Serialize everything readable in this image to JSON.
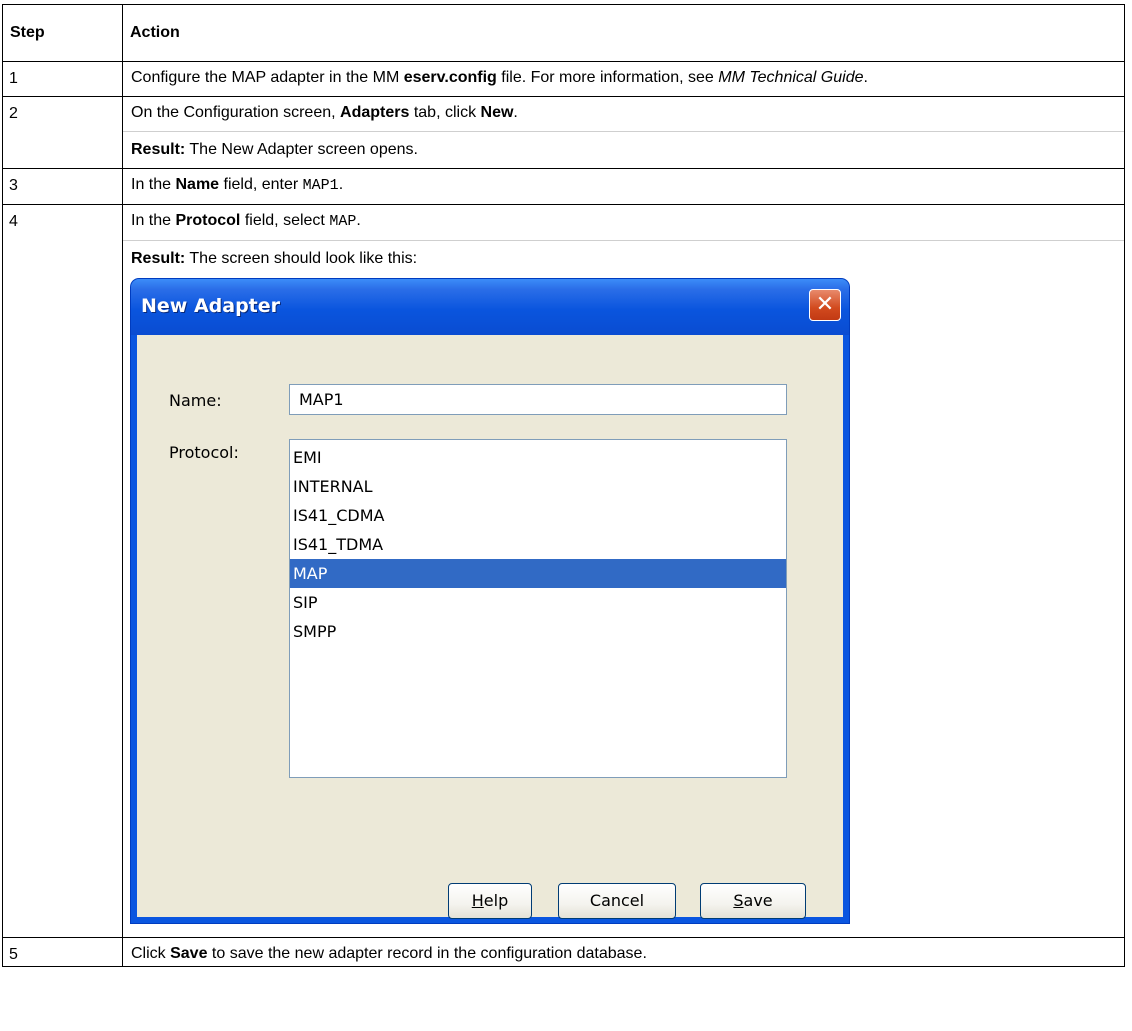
{
  "table": {
    "headers": {
      "step": "Step",
      "action": "Action"
    },
    "step1": {
      "num": "1",
      "t1": "Configure the MAP adapter in the MM ",
      "b1": "eserv.config",
      "t2": " file. For more information, see ",
      "i1": "MM Technical Guide",
      "t3": "."
    },
    "step2": {
      "num": "2",
      "t1": "On the Configuration screen, ",
      "b1": "Adapters",
      "t2": " tab, click ",
      "b2": "New",
      "t3": ".",
      "result_label": "Result:",
      "result_text": " The New Adapter screen opens."
    },
    "step3": {
      "num": "3",
      "t1": "In the ",
      "b1": "Name",
      "t2": " field, enter ",
      "code": "MAP1",
      "t3": "."
    },
    "step4": {
      "num": "4",
      "t1": "In the ",
      "b1": "Protocol",
      "t2": " field, select ",
      "code": "MAP",
      "t3": ".",
      "result_label": "Result:",
      "result_text": " The screen should look like this:"
    },
    "step5": {
      "num": "5",
      "t1": "Click ",
      "b1": "Save",
      "t2": " to save the new adapter record in the configuration database."
    }
  },
  "dialog": {
    "title": "New Adapter",
    "close_glyph": "✕",
    "name_label": "Name:",
    "name_value": "MAP1",
    "protocol_label": "Protocol:",
    "protocols": [
      "EMI",
      "INTERNAL",
      "IS41_CDMA",
      "IS41_TDMA",
      "MAP",
      "SIP",
      "SMPP"
    ],
    "selected_protocol": "MAP",
    "buttons": {
      "help": {
        "mnemonic": "H",
        "rest": "elp"
      },
      "cancel": "Cancel",
      "save": {
        "mnemonic": "S",
        "rest": "ave"
      }
    }
  }
}
